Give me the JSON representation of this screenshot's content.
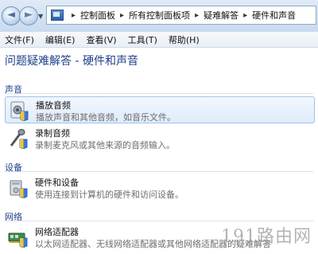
{
  "breadcrumb": [
    "控制面板",
    "所有控制面板项",
    "疑难解答",
    "硬件和声音"
  ],
  "menu": [
    "文件(F)",
    "编辑(E)",
    "查看(V)",
    "工具(T)",
    "帮助(H)"
  ],
  "page_title": "问题疑难解答 - 硬件和声音",
  "groups": {
    "sound": {
      "label": "声音",
      "items": [
        {
          "title": "播放音频",
          "desc": "播放声音和其他音频，如音乐文件。",
          "icon": "speaker-icon"
        },
        {
          "title": "录制音频",
          "desc": "录制麦克风或其他来源的音频输入。",
          "icon": "microphone-icon"
        }
      ]
    },
    "device": {
      "label": "设备",
      "items": [
        {
          "title": "硬件和设备",
          "desc": "使用连接到计算机的硬件和访问设备。",
          "icon": "hardware-icon"
        }
      ]
    },
    "network": {
      "label": "网络",
      "items": [
        {
          "title": "网络适配器",
          "desc": "以太网适配器、无线网络适配器或其他网络适配器的疑难解答",
          "icon": "network-adapter-icon"
        }
      ]
    }
  },
  "watermark": "191路由网",
  "colors": {
    "accent": "#1e3f8a",
    "selected_bg": "#dfecfb"
  }
}
